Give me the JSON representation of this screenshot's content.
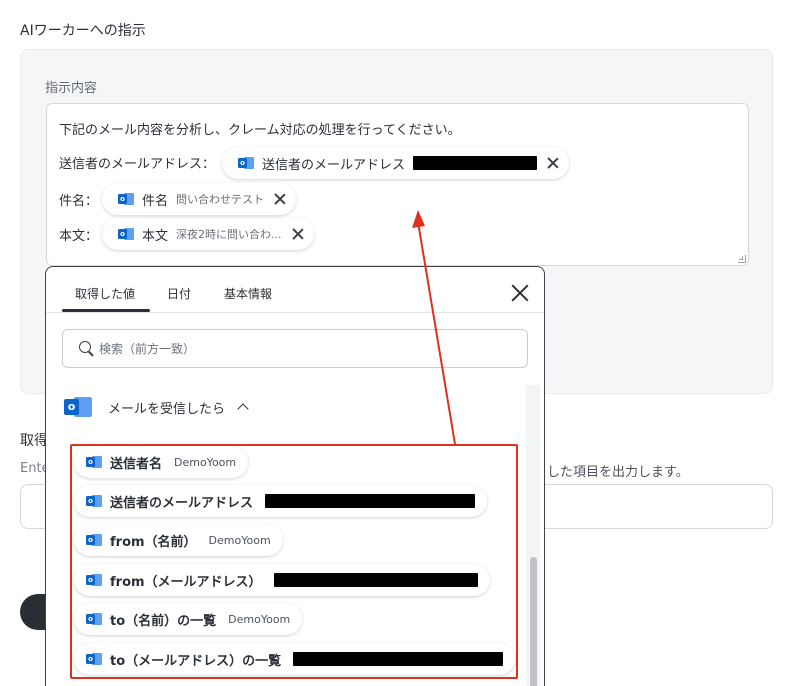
{
  "section_title": "AIワーカーへの指示",
  "card": {
    "label": "指示内容",
    "lines": {
      "intro": "下記のメール内容を分析し、クレーム対応の処理を行ってください。",
      "sender_prefix": "送信者のメールアドレス：",
      "subject_prefix": "件名：",
      "body_prefix": "本文："
    },
    "chips": [
      {
        "label": "送信者のメールアドレス",
        "sub": "",
        "icon": "outlook-icon"
      },
      {
        "label": "件名",
        "sub": "問い合わせテスト",
        "icon": "outlook-icon"
      },
      {
        "label": "本文",
        "sub": "深夜2時に問い合わ...",
        "icon": "outlook-icon"
      }
    ]
  },
  "behind": {
    "title": "取得",
    "desc_left": "Ente",
    "desc_right": "した項目を出力します。"
  },
  "popup": {
    "tabs": [
      "取得した値",
      "日付",
      "基本情報"
    ],
    "active_tab": 0,
    "search_placeholder": "検索（前方一致）",
    "group_label": "メールを受信したら",
    "items": [
      {
        "label": "送信者名",
        "sub": "DemoYoom",
        "redacted": false
      },
      {
        "label": "送信者のメールアドレス",
        "sub": "",
        "redacted": true
      },
      {
        "label": "from（名前）",
        "sub": "DemoYoom",
        "redacted": false
      },
      {
        "label": "from（メールアドレス）",
        "sub": "",
        "redacted": true
      },
      {
        "label": "to（名前）の一覧",
        "sub": "DemoYoom",
        "redacted": false
      },
      {
        "label": "to（メールアドレス）の一覧",
        "sub": "",
        "redacted": true
      }
    ]
  },
  "colors": {
    "highlight": "#e0301e",
    "outlook_dark": "#0a64c9",
    "outlook_light": "#5ea0ef"
  }
}
